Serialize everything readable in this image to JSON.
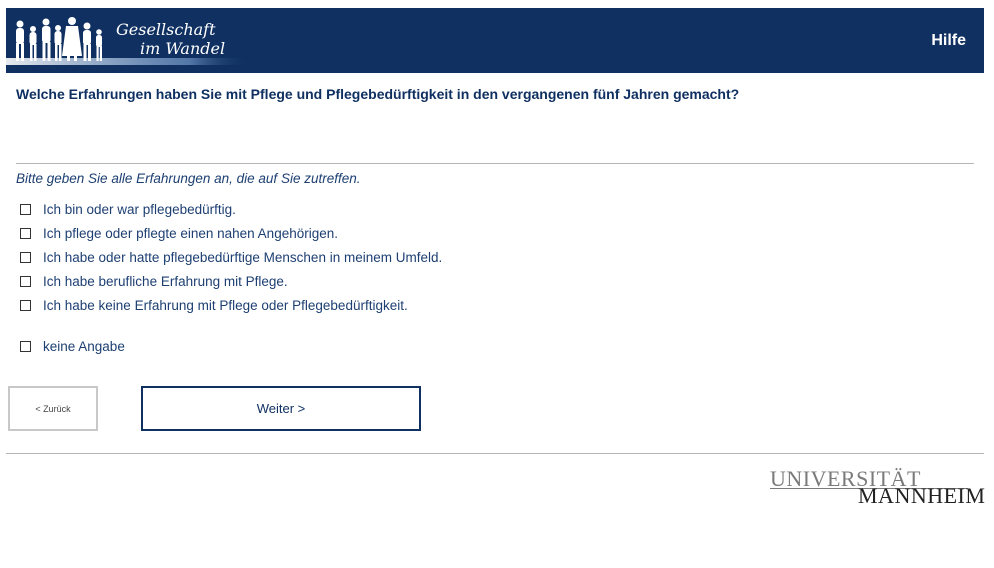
{
  "header": {
    "logo_line1": "Gesellschaft",
    "logo_line2": "im Wandel",
    "help_label": "Hilfe",
    "background_color": "#0f3061"
  },
  "question": {
    "text": "Welche Erfahrungen haben Sie mit Pflege und Pflegebedürftigkeit in den vergangenen fünf Jahren gemacht?",
    "instruction": "Bitte geben Sie alle Erfahrungen an, die auf Sie zutreffen."
  },
  "options": [
    {
      "label": "Ich bin oder war pflegebedürftig.",
      "checked": false
    },
    {
      "label": "Ich pflege oder pflegte einen nahen Angehörigen.",
      "checked": false
    },
    {
      "label": "Ich habe oder hatte pflegebedürftige Menschen in meinem Umfeld.",
      "checked": false
    },
    {
      "label": "Ich habe berufliche Erfahrung mit Pflege.",
      "checked": false
    },
    {
      "label": "Ich habe keine Erfahrung mit Pflege oder Pflegebedürftigkeit.",
      "checked": false
    }
  ],
  "no_answer": {
    "label": "keine Angabe",
    "checked": false
  },
  "navigation": {
    "back_label": "< Zurück",
    "next_label": "Weiter >"
  },
  "footer": {
    "university_line1": "UNIVERSITÄT",
    "university_line2": "MANNHEIM"
  }
}
